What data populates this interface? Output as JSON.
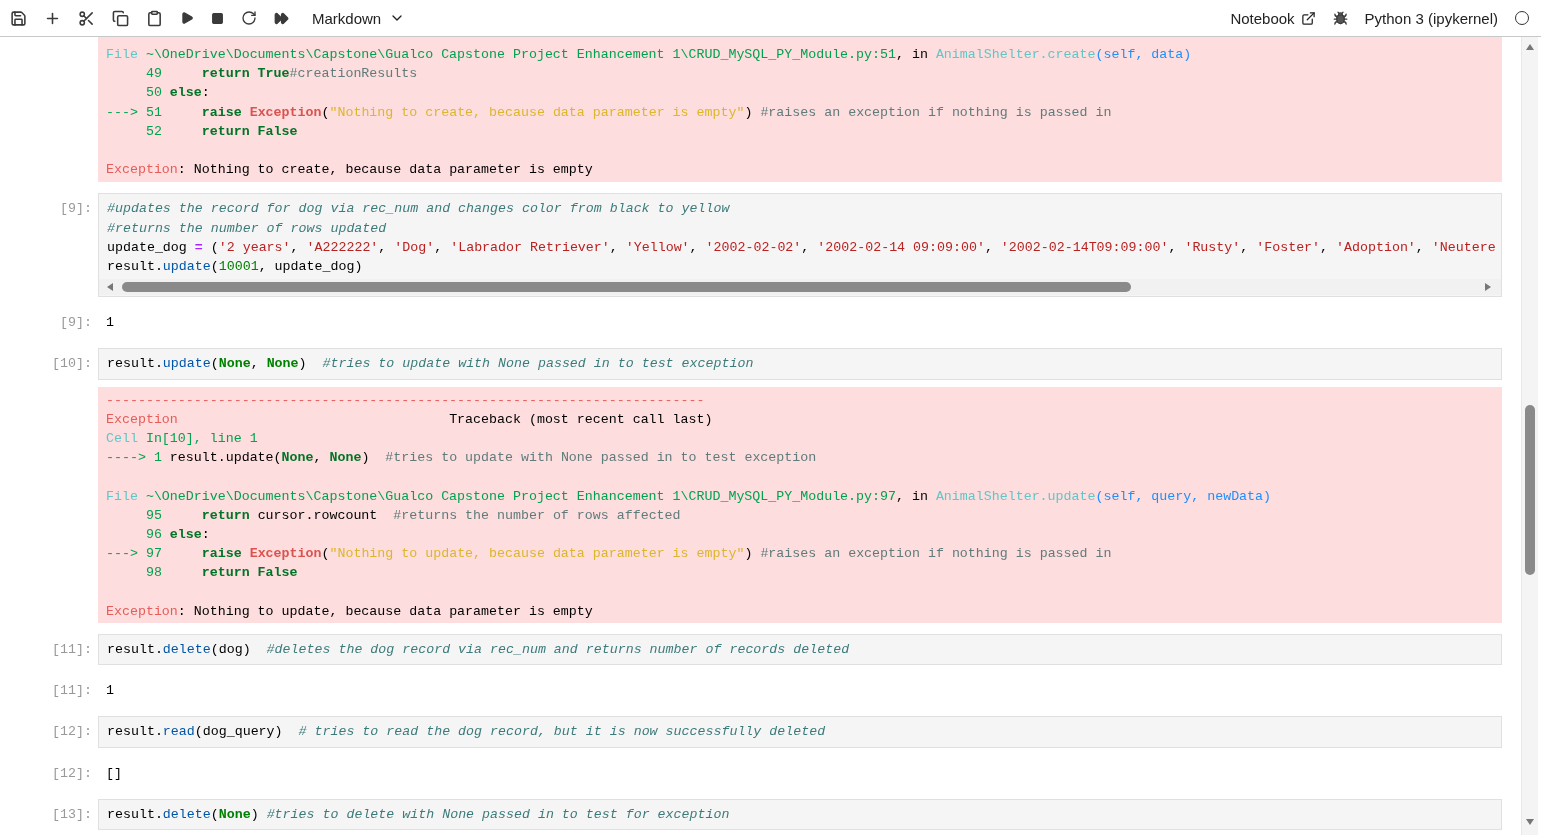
{
  "toolbar": {
    "cell_type": "Markdown",
    "notebook_label": "Notebook",
    "kernel": "Python 3 (ipykernel)",
    "kernel_busy": false
  },
  "cells": [
    {
      "kind": "error",
      "lines": [
        {
          "spans": [
            {
              "text": "File ",
              "kind": "ansi-cyan"
            },
            {
              "text": "~\\OneDrive\\Documents\\Capstone\\Gualco Capstone Project Enhancement 1\\CRUD_MySQL_PY_Module.py:51",
              "kind": "ansi-green"
            },
            {
              "text": ", in ",
              "kind": "plain"
            },
            {
              "text": "AnimalShelter.create",
              "kind": "ansi-cyan"
            },
            {
              "text": "(self, data)",
              "kind": "ansi-blue"
            }
          ]
        },
        {
          "spans": [
            {
              "text": "     49     ",
              "kind": "ansi-green"
            },
            {
              "text": "return True",
              "kind": "ansi-keyword"
            },
            {
              "text": "#creationResults",
              "kind": "ansi-comment"
            }
          ]
        },
        {
          "spans": [
            {
              "text": "     50 ",
              "kind": "ansi-green"
            },
            {
              "text": "else",
              "kind": "ansi-keyword"
            },
            {
              "text": ":",
              "kind": "plain"
            }
          ]
        },
        {
          "spans": [
            {
              "text": "---> 51     ",
              "kind": "ansi-green"
            },
            {
              "text": "raise ",
              "kind": "ansi-keyword"
            },
            {
              "text": "Exception",
              "kind": "ansi-exception"
            },
            {
              "text": "(",
              "kind": "plain"
            },
            {
              "text": "\"Nothing to create, because data parameter is empty\"",
              "kind": "ansi-string"
            },
            {
              "text": ") ",
              "kind": "plain"
            },
            {
              "text": "#raises an exception if nothing is passed in",
              "kind": "ansi-comment"
            }
          ]
        },
        {
          "spans": [
            {
              "text": "     52     ",
              "kind": "ansi-green"
            },
            {
              "text": "return False",
              "kind": "ansi-keyword"
            }
          ]
        },
        {
          "gap": true,
          "spans": [
            {
              "text": "Exception",
              "kind": "ansi-red"
            },
            {
              "text": ": Nothing to create, because data parameter is empty",
              "kind": "plain"
            }
          ]
        }
      ]
    },
    {
      "kind": "input",
      "prompt": "[9]:",
      "scrollable": true,
      "lines": [
        {
          "spans": [
            {
              "text": "#updates the record for dog via rec_num and changes color from black to yellow",
              "kind": "comment"
            }
          ]
        },
        {
          "spans": [
            {
              "text": "#returns the number of rows updated",
              "kind": "comment"
            }
          ]
        },
        {
          "spans": [
            {
              "text": "update_dog ",
              "kind": "plain"
            },
            {
              "text": "=",
              "kind": "operator"
            },
            {
              "text": " (",
              "kind": "plain"
            },
            {
              "text": "'2 years'",
              "kind": "string"
            },
            {
              "text": ", ",
              "kind": "plain"
            },
            {
              "text": "'A222222'",
              "kind": "string"
            },
            {
              "text": ", ",
              "kind": "plain"
            },
            {
              "text": "'Dog'",
              "kind": "string"
            },
            {
              "text": ", ",
              "kind": "plain"
            },
            {
              "text": "'Labrador Retriever'",
              "kind": "string"
            },
            {
              "text": ", ",
              "kind": "plain"
            },
            {
              "text": "'Yellow'",
              "kind": "string"
            },
            {
              "text": ", ",
              "kind": "plain"
            },
            {
              "text": "'2002-02-02'",
              "kind": "string"
            },
            {
              "text": ", ",
              "kind": "plain"
            },
            {
              "text": "'2002-02-14 09:09:00'",
              "kind": "string"
            },
            {
              "text": ", ",
              "kind": "plain"
            },
            {
              "text": "'2002-02-14T09:09:00'",
              "kind": "string"
            },
            {
              "text": ", ",
              "kind": "plain"
            },
            {
              "text": "'Rusty'",
              "kind": "string"
            },
            {
              "text": ", ",
              "kind": "plain"
            },
            {
              "text": "'Foster'",
              "kind": "string"
            },
            {
              "text": ", ",
              "kind": "plain"
            },
            {
              "text": "'Adoption'",
              "kind": "string"
            },
            {
              "text": ", ",
              "kind": "plain"
            },
            {
              "text": "'Neutere",
              "kind": "string"
            }
          ]
        },
        {
          "spans": [
            {
              "text": "result.",
              "kind": "plain"
            },
            {
              "text": "update",
              "kind": "function"
            },
            {
              "text": "(",
              "kind": "plain"
            },
            {
              "text": "10001",
              "kind": "number"
            },
            {
              "text": ", update_dog)",
              "kind": "plain"
            }
          ]
        }
      ]
    },
    {
      "kind": "output",
      "prompt": "[9]:",
      "lines": [
        {
          "spans": [
            {
              "text": "1",
              "kind": "plain"
            }
          ]
        }
      ]
    },
    {
      "kind": "input",
      "prompt": "[10]:",
      "lines": [
        {
          "spans": [
            {
              "text": "result.",
              "kind": "plain"
            },
            {
              "text": "update",
              "kind": "function"
            },
            {
              "text": "(",
              "kind": "plain"
            },
            {
              "text": "None",
              "kind": "keyword"
            },
            {
              "text": ", ",
              "kind": "plain"
            },
            {
              "text": "None",
              "kind": "keyword"
            },
            {
              "text": ")  ",
              "kind": "plain"
            },
            {
              "text": "#tries to update with None passed in to test exception",
              "kind": "comment"
            }
          ]
        }
      ]
    },
    {
      "kind": "error",
      "lines": [
        {
          "spans": [
            {
              "text": "---------------------------------------------------------------------------",
              "kind": "ansi-red"
            }
          ]
        },
        {
          "spans": [
            {
              "text": "Exception",
              "kind": "ansi-red"
            },
            {
              "text": "                                  Traceback (most recent call last)",
              "kind": "plain"
            }
          ]
        },
        {
          "spans": [
            {
              "text": "Cell ",
              "kind": "ansi-cyan"
            },
            {
              "text": "In[10], line 1",
              "kind": "ansi-green"
            }
          ]
        },
        {
          "spans": [
            {
              "text": "----> 1 ",
              "kind": "ansi-green"
            },
            {
              "text": "result.update(",
              "kind": "plain"
            },
            {
              "text": "None",
              "kind": "ansi-keyword"
            },
            {
              "text": ", ",
              "kind": "plain"
            },
            {
              "text": "None",
              "kind": "ansi-keyword"
            },
            {
              "text": ")  ",
              "kind": "plain"
            },
            {
              "text": "#tries to update with None passed in to test exception",
              "kind": "ansi-comment"
            }
          ]
        },
        {
          "gap": true,
          "spans": [
            {
              "text": "File ",
              "kind": "ansi-cyan"
            },
            {
              "text": "~\\OneDrive\\Documents\\Capstone\\Gualco Capstone Project Enhancement 1\\CRUD_MySQL_PY_Module.py:97",
              "kind": "ansi-green"
            },
            {
              "text": ", in ",
              "kind": "plain"
            },
            {
              "text": "AnimalShelter.update",
              "kind": "ansi-cyan"
            },
            {
              "text": "(self, query, newData)",
              "kind": "ansi-blue"
            }
          ]
        },
        {
          "spans": [
            {
              "text": "     95     ",
              "kind": "ansi-green"
            },
            {
              "text": "return",
              "kind": "ansi-keyword"
            },
            {
              "text": " cursor.rowcount  ",
              "kind": "plain"
            },
            {
              "text": "#returns the number of rows affected",
              "kind": "ansi-comment"
            }
          ]
        },
        {
          "spans": [
            {
              "text": "     96 ",
              "kind": "ansi-green"
            },
            {
              "text": "else",
              "kind": "ansi-keyword"
            },
            {
              "text": ":",
              "kind": "plain"
            }
          ]
        },
        {
          "spans": [
            {
              "text": "---> 97     ",
              "kind": "ansi-green"
            },
            {
              "text": "raise ",
              "kind": "ansi-keyword"
            },
            {
              "text": "Exception",
              "kind": "ansi-exception"
            },
            {
              "text": "(",
              "kind": "plain"
            },
            {
              "text": "\"Nothing to update, because data parameter is empty\"",
              "kind": "ansi-string"
            },
            {
              "text": ") ",
              "kind": "plain"
            },
            {
              "text": "#raises an exception if nothing is passed in",
              "kind": "ansi-comment"
            }
          ]
        },
        {
          "spans": [
            {
              "text": "     98     ",
              "kind": "ansi-green"
            },
            {
              "text": "return False",
              "kind": "ansi-keyword"
            }
          ]
        },
        {
          "gap": true,
          "spans": [
            {
              "text": "Exception",
              "kind": "ansi-red"
            },
            {
              "text": ": Nothing to update, because data parameter is empty",
              "kind": "plain"
            }
          ]
        }
      ]
    },
    {
      "kind": "input",
      "prompt": "[11]:",
      "lines": [
        {
          "spans": [
            {
              "text": "result.",
              "kind": "plain"
            },
            {
              "text": "delete",
              "kind": "function"
            },
            {
              "text": "(dog)  ",
              "kind": "plain"
            },
            {
              "text": "#deletes the dog record via rec_num and returns number of records deleted",
              "kind": "comment"
            }
          ]
        }
      ]
    },
    {
      "kind": "output",
      "prompt": "[11]:",
      "lines": [
        {
          "spans": [
            {
              "text": "1",
              "kind": "plain"
            }
          ]
        }
      ]
    },
    {
      "kind": "input",
      "prompt": "[12]:",
      "lines": [
        {
          "spans": [
            {
              "text": "result.",
              "kind": "plain"
            },
            {
              "text": "read",
              "kind": "function"
            },
            {
              "text": "(dog_query)  ",
              "kind": "plain"
            },
            {
              "text": "# tries to read the dog record, but it is now successfully deleted",
              "kind": "comment"
            }
          ]
        }
      ]
    },
    {
      "kind": "output",
      "prompt": "[12]:",
      "lines": [
        {
          "spans": [
            {
              "text": "[]",
              "kind": "plain"
            }
          ]
        }
      ]
    },
    {
      "kind": "input",
      "prompt": "[13]:",
      "lines": [
        {
          "spans": [
            {
              "text": "result.",
              "kind": "plain"
            },
            {
              "text": "delete",
              "kind": "function"
            },
            {
              "text": "(",
              "kind": "plain"
            },
            {
              "text": "None",
              "kind": "keyword"
            },
            {
              "text": ") ",
              "kind": "plain"
            },
            {
              "text": "#tries to delete with None passed in to test for exception",
              "kind": "comment"
            }
          ]
        }
      ]
    }
  ]
}
